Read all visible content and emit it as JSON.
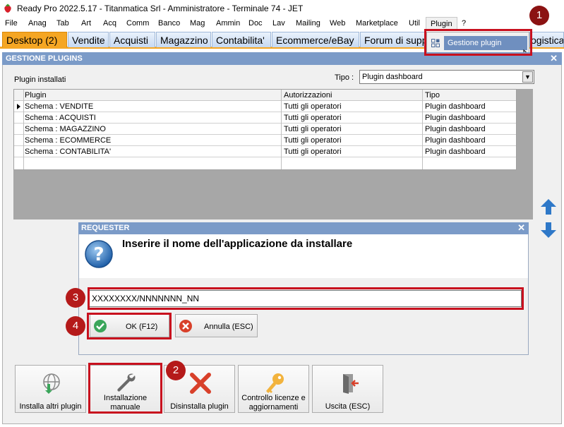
{
  "window": {
    "title": "Ready Pro 2022.5.17 - Titanmatica Srl - Amministratore - Terminale 74 - JET"
  },
  "menu": [
    "File",
    "Anag",
    "Tab",
    "Art",
    "Acq",
    "Comm",
    "Banco",
    "Mag",
    "Ammin",
    "Doc",
    "Lav",
    "Mailing",
    "Web",
    "Marketplace",
    "Util",
    "Plugin",
    "?"
  ],
  "tabs": [
    "Desktop (2)",
    "Vendite",
    "Acquisti",
    "Magazzino",
    "Contabilita'",
    "Ecommerce/eBay",
    "Forum di supp",
    "ogistica"
  ],
  "plugin_menu": {
    "item": "Gestione plugin"
  },
  "panel": {
    "title": "GESTIONE PLUGINS",
    "installed_label": "Plugin installati",
    "tipo_label": "Tipo :",
    "tipo_value": "Plugin dashboard"
  },
  "grid": {
    "columns": [
      "Plugin",
      "Autorizzazioni",
      "Tipo"
    ],
    "rows": [
      [
        "Schema : VENDITE",
        "Tutti gli operatori",
        "Plugin dashboard"
      ],
      [
        "Schema : ACQUISTI",
        "Tutti gli operatori",
        "Plugin dashboard"
      ],
      [
        "Schema : MAGAZZINO",
        "Tutti gli operatori",
        "Plugin dashboard"
      ],
      [
        "Schema : ECOMMERCE",
        "Tutti gli operatori",
        "Plugin dashboard"
      ],
      [
        "Schema : CONTABILITA'",
        "Tutti gli operatori",
        "Plugin dashboard"
      ]
    ]
  },
  "requester": {
    "title": "REQUESTER",
    "prompt": "Inserire il nome dell'applicazione da installare",
    "input_value": "XXXXXXXX/NNNNNNN_NN",
    "ok_label": "OK (F12)",
    "cancel_label": "Annulla (ESC)"
  },
  "toolbar": {
    "install_other": "Installa altri plugin",
    "manual_install_1": "Installazione",
    "manual_install_2": "manuale",
    "uninstall": "Disinstalla plugin",
    "license_1": "Controllo licenze e",
    "license_2": "aggiornamenti",
    "exit": "Uscita (ESC)"
  },
  "badges": [
    "1",
    "2",
    "3",
    "4"
  ],
  "colors": {
    "panel_header": "#7b9bc8",
    "active_tab": "#f5a623",
    "highlight": "#c8101e",
    "badge": "#b51a1a"
  }
}
